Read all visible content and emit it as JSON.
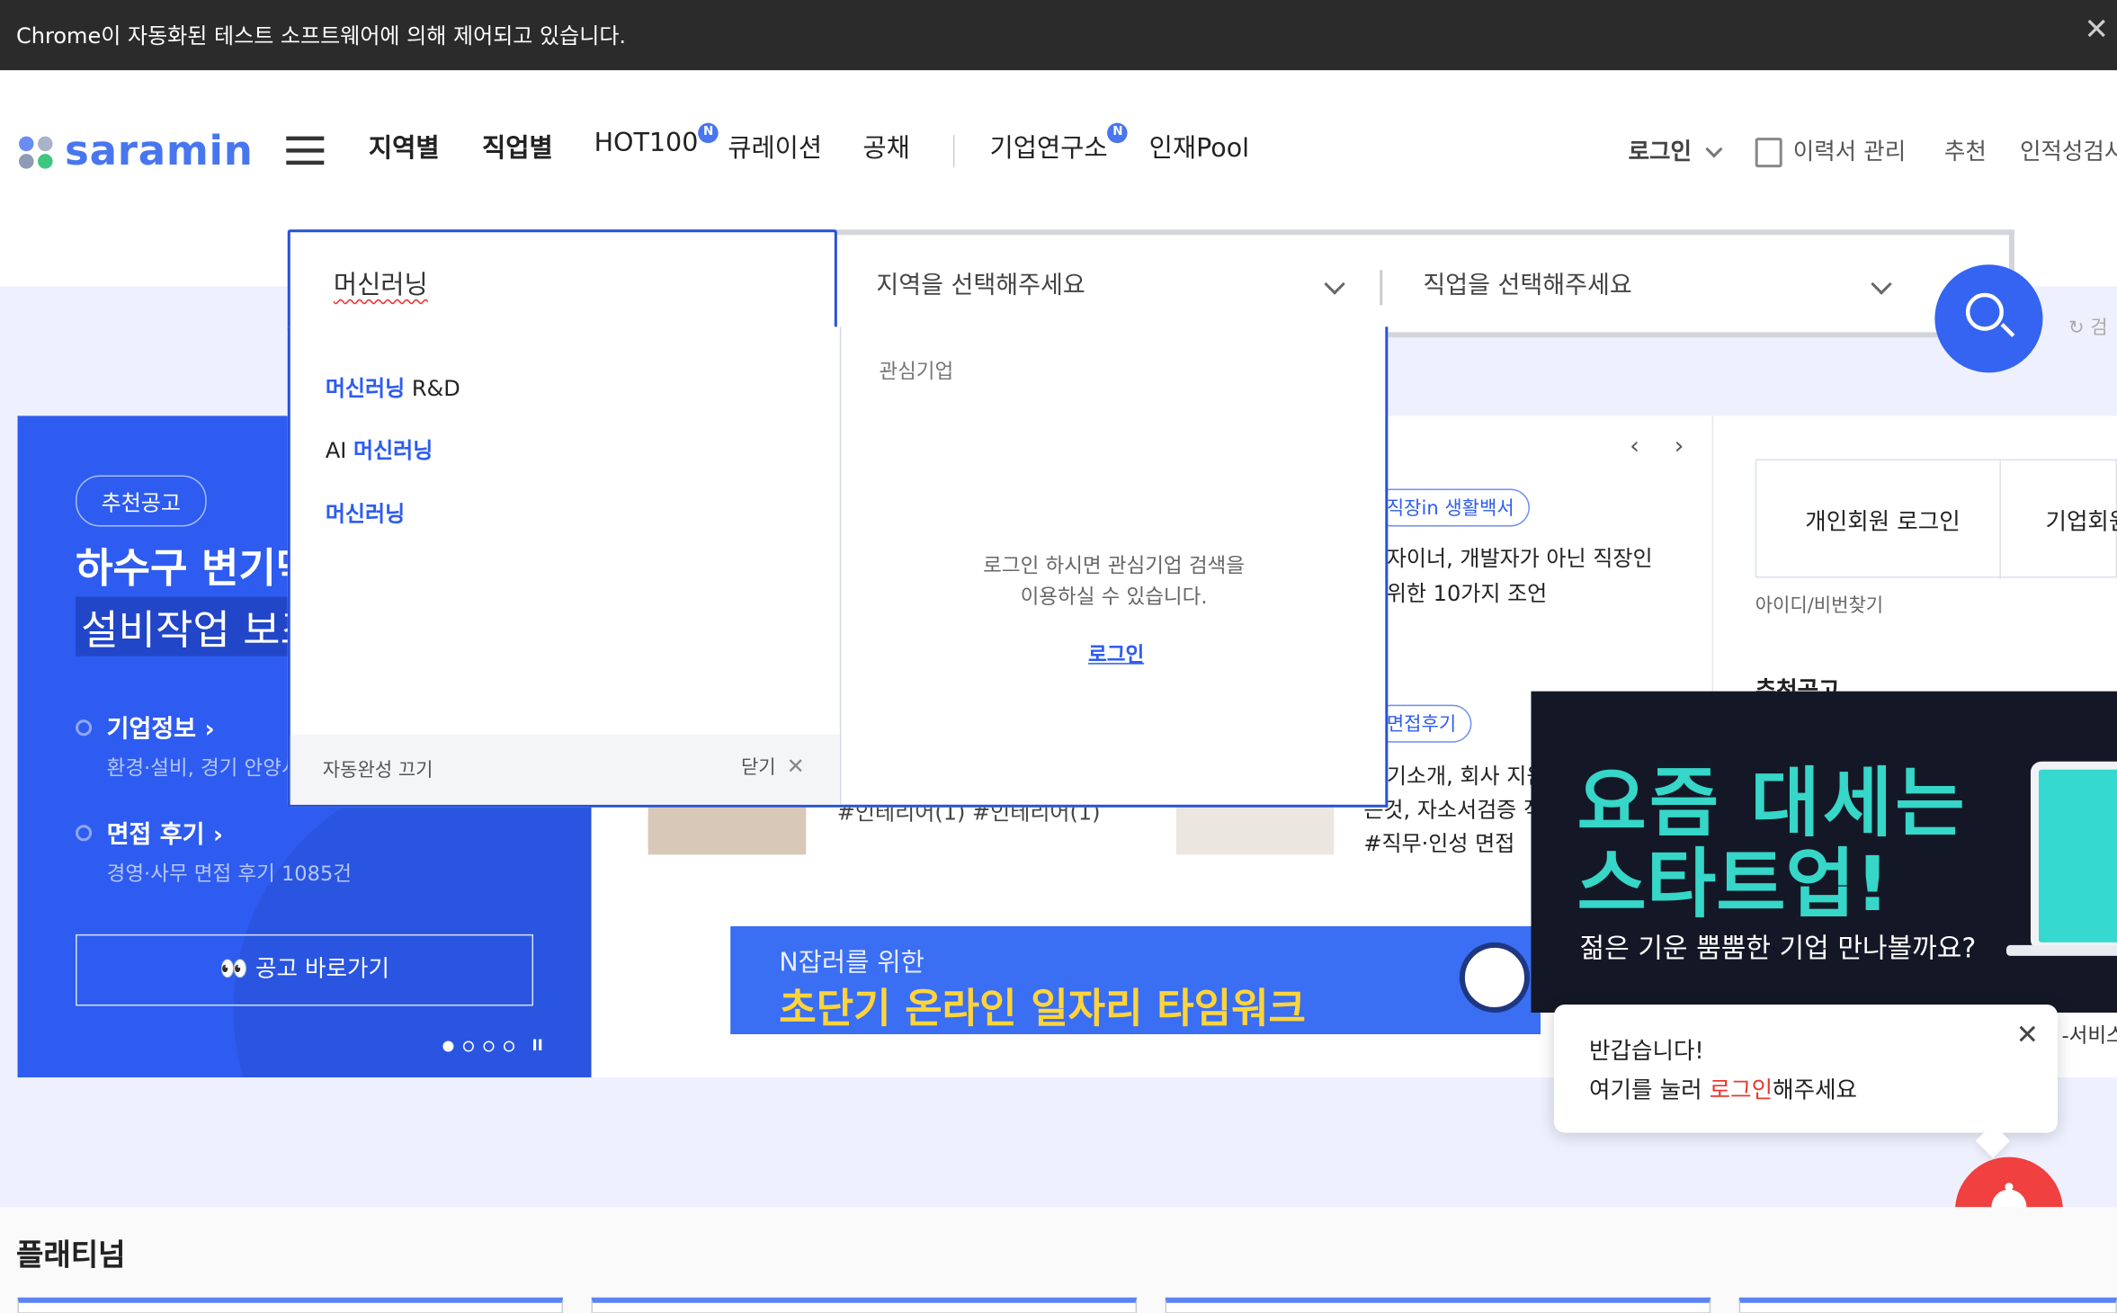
{
  "automation_bar": {
    "message": "Chrome이 자동화된 테스트 소프트웨어에 의해 제어되고 있습니다.",
    "close": "✕"
  },
  "header": {
    "logo": "saramin",
    "nav": [
      {
        "label": "지역별"
      },
      {
        "label": "직업별"
      },
      {
        "label": "HOT100",
        "badge": "N"
      },
      {
        "label": "큐레이션"
      },
      {
        "label": "공채"
      },
      {
        "label": "기업연구소",
        "badge": "N"
      },
      {
        "label": "인재Pool"
      }
    ],
    "util": {
      "login": "로그인",
      "resume": "이력서 관리",
      "recommend": "추천",
      "aptitude": "인적성검사"
    }
  },
  "search": {
    "query": "머신러닝",
    "region_placeholder": "지역을 선택해주세요",
    "job_placeholder": "직업을 선택해주세요",
    "recent_label": "검"
  },
  "autocomplete": {
    "items": [
      {
        "highlight": "머신러닝",
        "rest": " R&D",
        "prefix": ""
      },
      {
        "prefix": "AI ",
        "highlight": "머신러닝",
        "rest": ""
      },
      {
        "prefix": "",
        "highlight": "머신러닝",
        "rest": ""
      }
    ],
    "turn_off": "자동완성 끄기",
    "close": "닫기",
    "close_icon": "✕",
    "interest_header": "관심기업",
    "message_l1": "로그인 하시면 관심기업 검색을",
    "message_l2": "이용하실 수 있습니다.",
    "login_link": "로그인"
  },
  "promo": {
    "pill": "추천공고",
    "title": "하수구 변기막",
    "subtitle": "설비작업 보조",
    "company_info": "기업정보",
    "company_desc": "환경·설비, 경기 안양시",
    "interview": "면접 후기",
    "interview_desc": "경영·사무 면접 후기 1085건",
    "button": "👀 공고 바로가기",
    "pause": "II"
  },
  "feed": {
    "tag1": "직장in 생활백서",
    "line1a": "자이너, 개발자가 아닌 직장인",
    "line1b": "위한 10가지 조언",
    "tag2": "면접후기",
    "line2a": "기소개, 회사 지원",
    "line2b": "는것, 자소서검증 직",
    "line2c": "#직무·인성 면접",
    "left_caption": "#인테리어(1) #인테리어(1)"
  },
  "banner": {
    "line1": "N잡러를 위한",
    "line2": "초단기 온라인 일자리 타임워크"
  },
  "right_panel": {
    "personal_login": "개인회원 로그인",
    "corp_login": "기업회원",
    "find_id": "아이디/비번찾기",
    "recommend_header": "추천공고"
  },
  "ad": {
    "headline1": "요즘 대세는",
    "headline2": "스타트업!",
    "sub": "젊은 기운 뿜뿜한 기업 만나볼까요?"
  },
  "tooltip": {
    "line1": "반갑습니다!",
    "line2_pre": "여기를 눌러 ",
    "line2_link": "로그인",
    "line2_post": "해주세요",
    "close": "✕"
  },
  "service_text": "-서비스",
  "bottom": {
    "section_title": "플래티넘"
  },
  "colors": {
    "brand": "#4876ef",
    "accent_blue": "#2e5cf0",
    "promo_bg": "#2e5cf0",
    "alert_red": "#f04040",
    "ad_teal": "#36d6c8"
  },
  "icons": {
    "menu": "hamburger-icon",
    "search": "search-icon",
    "bell": "bell-icon",
    "resume": "resume-icon",
    "chevron": "chevron-down-icon"
  }
}
